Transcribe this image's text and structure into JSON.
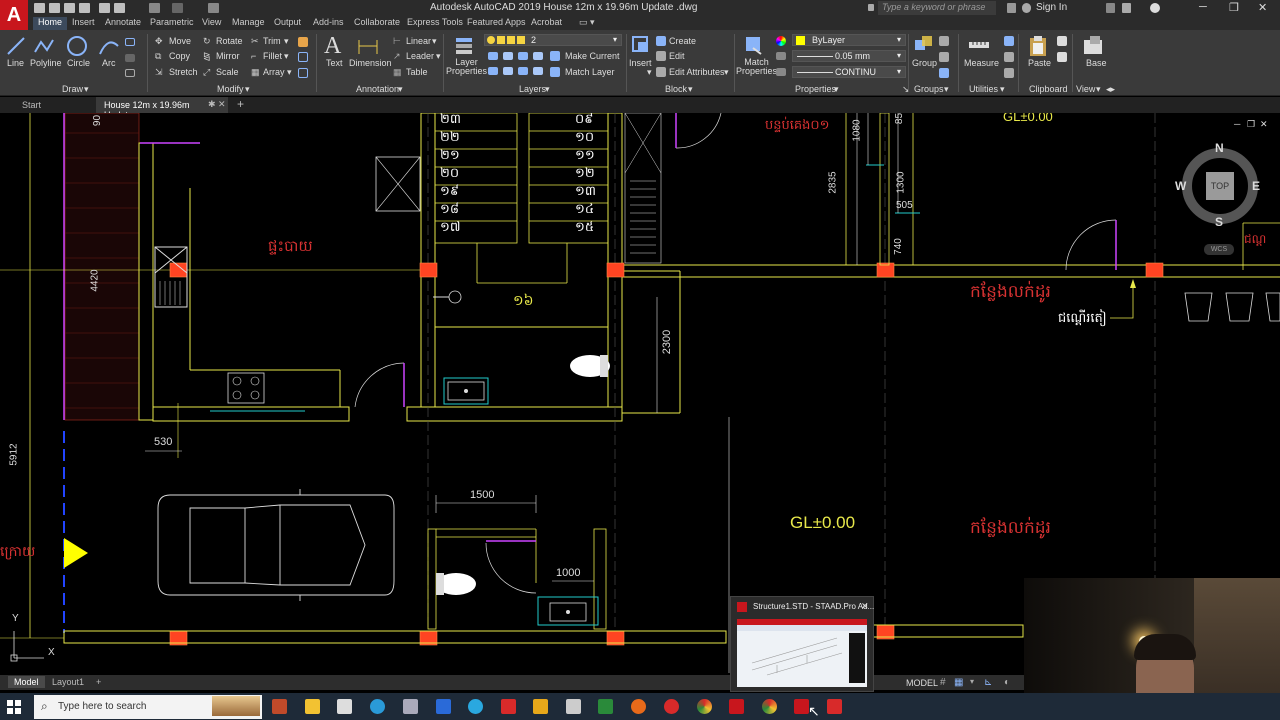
{
  "titlebar": {
    "title": "Autodesk AutoCAD 2019    House 12m x 19.96m Update .dwg",
    "search_placeholder": "Type a keyword or phrase",
    "signin": "Sign In"
  },
  "ribbon_tabs": [
    "Home",
    "Insert",
    "Annotate",
    "Parametric",
    "View",
    "Manage",
    "Output",
    "Add-ins",
    "Collaborate",
    "Express Tools",
    "Featured Apps",
    "Acrobat"
  ],
  "ribbon": {
    "draw": {
      "line": "Line",
      "polyline": "Polyline",
      "circle": "Circle",
      "arc": "Arc",
      "title": "Draw"
    },
    "modify": {
      "move": "Move",
      "rotate": "Rotate",
      "trim": "Trim",
      "copy": "Copy",
      "mirror": "Mirror",
      "fillet": "Fillet",
      "stretch": "Stretch",
      "scale": "Scale",
      "array": "Array",
      "title": "Modify"
    },
    "annotation": {
      "text": "Text",
      "dimension": "Dimension",
      "linear": "Linear",
      "leader": "Leader",
      "table": "Table",
      "title": "Annotation"
    },
    "layers": {
      "layer_properties": "Layer\nProperties",
      "layer_name": "2",
      "make_current": "Make Current",
      "match_layer": "Match Layer",
      "title": "Layers"
    },
    "block": {
      "insert": "Insert",
      "create": "Create",
      "edit": "Edit",
      "edit_attributes": "Edit Attributes",
      "title": "Block"
    },
    "properties": {
      "match": "Match\nProperties",
      "bylayer": "ByLayer",
      "lineweight": "0.05 mm",
      "linetype": "CONTINU",
      "title": "Properties"
    },
    "groups": {
      "group": "Group",
      "title": "Groups"
    },
    "utilities": {
      "measure": "Measure",
      "title": "Utilities"
    },
    "clipboard": {
      "paste": "Paste",
      "title": "Clipboard"
    },
    "view": {
      "base": "Base",
      "title": "View"
    }
  },
  "file_tabs": {
    "start": "Start",
    "current": "House 12m x 19.96m Update"
  },
  "drawing": {
    "dims": {
      "d90": "90",
      "d4420": "4420",
      "d5912": "5912",
      "d530": "530",
      "d2300": "2300",
      "d1500": "1500",
      "d1000": "1000",
      "d1080": "1080",
      "d2835": "2835",
      "d1300": "1300",
      "d505": "505",
      "d740": "740",
      "d85": "85"
    },
    "gl_top": "GL±0.00",
    "gl_main": "GL±0.00",
    "stair_left": [
      "២៣",
      "២២",
      "២១",
      "២០",
      "១៩",
      "១៨",
      "១៧"
    ],
    "stair_right": [
      "០៩",
      "១០",
      "១១",
      "១២",
      "១៣",
      "១៤",
      "១៥"
    ],
    "stair_16": "១៦",
    "kitchen_label": "ផ្ទះបាយ",
    "room_top_right": "បន្ទប់គេង០១",
    "garden_label_1": "កន្លែងលក់ដូរ",
    "garden_label_2": "កន្លែងលក់ដូរ",
    "counter_label": "ជណ្ដើរតៀ",
    "left_label": "ក្រោយ",
    "right_label": "ជណ្ដ",
    "wcs": "WCS",
    "axis_y": "Y",
    "axis_x": "X"
  },
  "navcube": {
    "n": "N",
    "s": "S",
    "e": "E",
    "w": "W",
    "top": "TOP"
  },
  "layout_tabs": [
    "Model",
    "Layout1"
  ],
  "status": {
    "model": "MODEL"
  },
  "thumbnail": {
    "title": "Structure1.STD - STAAD.Pro Ad..."
  },
  "taskbar": {
    "search_placeholder": "Type here to search"
  },
  "colors": {
    "accent_red": "#c8161d",
    "wall": "#e8e84a",
    "column": "#ff4422",
    "text_red": "#d83232",
    "ribbon": "#3a3a3a"
  }
}
